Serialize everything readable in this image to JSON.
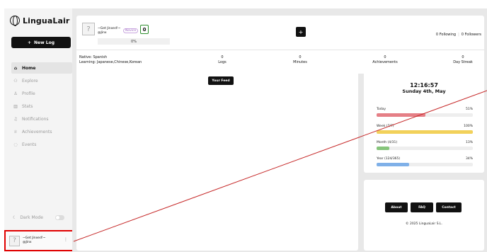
{
  "app": {
    "name": "LinguaLair"
  },
  "sidebar": {
    "new_log_label": "New Log",
    "new_log_icon": "+",
    "items": [
      {
        "label": "Home",
        "icon": "home-icon",
        "glyph": "⌂",
        "active": true
      },
      {
        "label": "Explore",
        "icon": "explore-icon",
        "glyph": "⚇",
        "active": false
      },
      {
        "label": "Profile",
        "icon": "user-icon",
        "glyph": "♙",
        "active": false
      },
      {
        "label": "Stats",
        "icon": "stats-icon",
        "glyph": "▥",
        "active": false
      },
      {
        "label": "Notifications",
        "icon": "bell-icon",
        "glyph": "♫",
        "active": false
      },
      {
        "label": "Achievements",
        "icon": "trophy-icon",
        "glyph": "♕",
        "active": false
      },
      {
        "label": "Events",
        "icon": "events-icon",
        "glyph": "◌",
        "active": false
      }
    ],
    "dark_mode_label": "Dark Mode",
    "dark_mode_icon": "☾",
    "dark_mode_on": false,
    "user": {
      "display_name": "~Get Jinxed!~",
      "username": "@Jinx",
      "menu": "⋮"
    }
  },
  "profile": {
    "display_name": "~Get Jinxed!~",
    "username": "@Jinx",
    "rank": "Novice",
    "streak": "0",
    "xp_percent": "0%",
    "add_button": "+",
    "following": "0 Following",
    "followers": "0 Followers",
    "native": "Native: Spanish",
    "learning": "Learning: Japanese,Chinese,Korean",
    "stats": [
      {
        "value": "0",
        "label": "Logs"
      },
      {
        "value": "0",
        "label": "Minutes"
      },
      {
        "value": "0",
        "label": "Achievements"
      },
      {
        "value": "0",
        "label": "Day Streak"
      }
    ]
  },
  "feed": {
    "button_label": "Your Feed"
  },
  "clock": {
    "time": "12:16:57",
    "date": "Sunday 4th, May",
    "goals": [
      {
        "label": "Today",
        "percent_label": "51%",
        "fill": 0.51,
        "color": "#e57f86"
      },
      {
        "label": "Week (7/7)",
        "percent_label": "100%",
        "fill": 1.0,
        "color": "#f2d15a"
      },
      {
        "label": "Month (4/31)",
        "percent_label": "13%",
        "fill": 0.13,
        "color": "#86c57b"
      },
      {
        "label": "Year (124/365)",
        "percent_label": "34%",
        "fill": 0.34,
        "color": "#7fb0e8"
      }
    ]
  },
  "footer": {
    "links": [
      "About",
      "FAQ",
      "Contact"
    ],
    "copyright": "© 2025 LinguaLair S.L."
  }
}
